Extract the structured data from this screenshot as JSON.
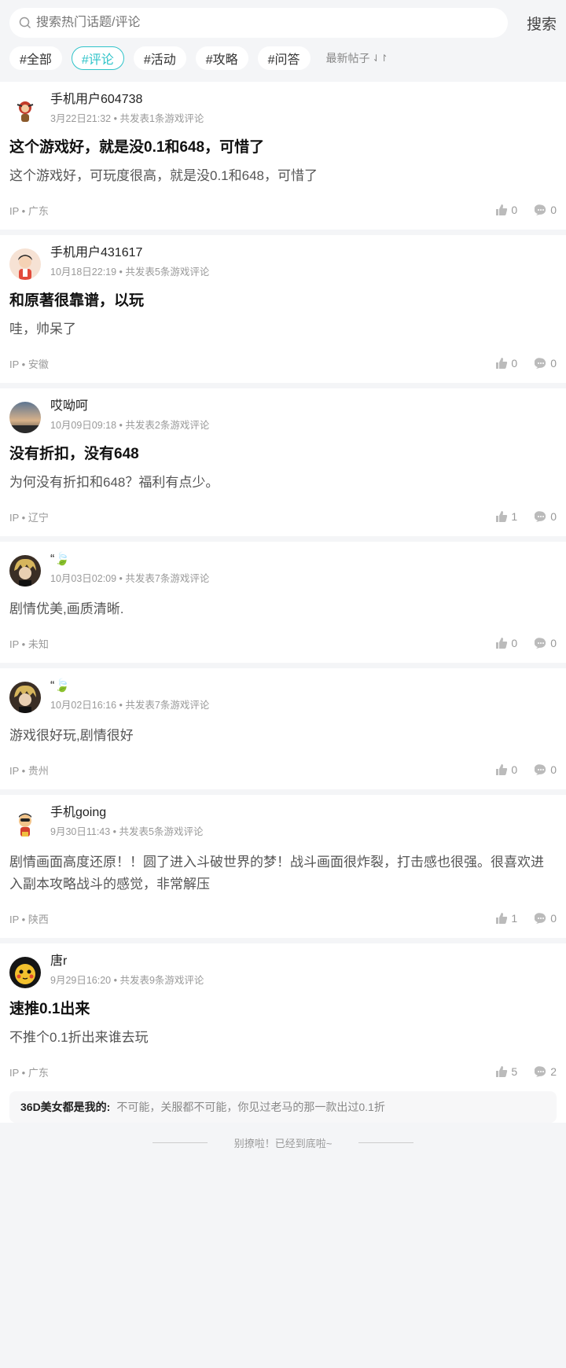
{
  "search": {
    "placeholder": "搜索热门话题/评论",
    "button": "搜索"
  },
  "tags": [
    "#全部",
    "#评论",
    "#活动",
    "#攻略",
    "#问答"
  ],
  "sort": {
    "label": "最新帖子"
  },
  "posts": [
    {
      "user": "手机用户604738",
      "meta": "3月22日21:32 • 共发表1条游戏评论",
      "title": "这个游戏好，就是没0.1和648，可惜了",
      "body": "这个游戏好，可玩度很高，就是没0.1和648，可惜了",
      "ip": "IP • 广东",
      "likes": "0",
      "comments": "0"
    },
    {
      "user": "手机用户431617",
      "meta": "10月18日22:19 • 共发表5条游戏评论",
      "title": "和原著很靠谱，以玩",
      "body": "哇，帅呆了",
      "ip": "IP • 安徽",
      "likes": "0",
      "comments": "0"
    },
    {
      "user": "哎呦呵",
      "meta": "10月09日09:18 • 共发表2条游戏评论",
      "title": "没有折扣，没有648",
      "body": "为何没有折扣和648？福利有点少。",
      "ip": "IP • 辽宁",
      "likes": "1",
      "comments": "0"
    },
    {
      "user": "“🍃",
      "meta": "10月03日02:09 • 共发表7条游戏评论",
      "title": "",
      "body": "剧情优美,画质清晰.",
      "ip": "IP • 未知",
      "likes": "0",
      "comments": "0"
    },
    {
      "user": "“🍃",
      "meta": "10月02日16:16 • 共发表7条游戏评论",
      "title": "",
      "body": "游戏很好玩,剧情很好",
      "ip": "IP • 贵州",
      "likes": "0",
      "comments": "0"
    },
    {
      "user": "手机going",
      "meta": "9月30日11:43 • 共发表5条游戏评论",
      "title": "",
      "body": "剧情画面高度还原！！圆了进入斗破世界的梦！战斗画面很炸裂，打击感也很强。很喜欢进入副本攻略战斗的感觉，非常解压",
      "ip": "IP • 陕西",
      "likes": "1",
      "comments": "0"
    },
    {
      "user": "唐r",
      "meta": "9月29日16:20 • 共发表9条游戏评论",
      "title": "速推0.1出来",
      "body": "不推个0.1折出来谁去玩",
      "ip": "IP • 广东",
      "likes": "5",
      "comments": "2"
    }
  ],
  "reply": {
    "name": "36D美女都是我的:",
    "text": "不可能，关服都不可能，你见过老马的那一款出过0.1折"
  },
  "end_text": "别撩啦！已经到底啦~",
  "colors": {
    "accent": "#2ec3c9",
    "bg": "#f4f5f7"
  }
}
